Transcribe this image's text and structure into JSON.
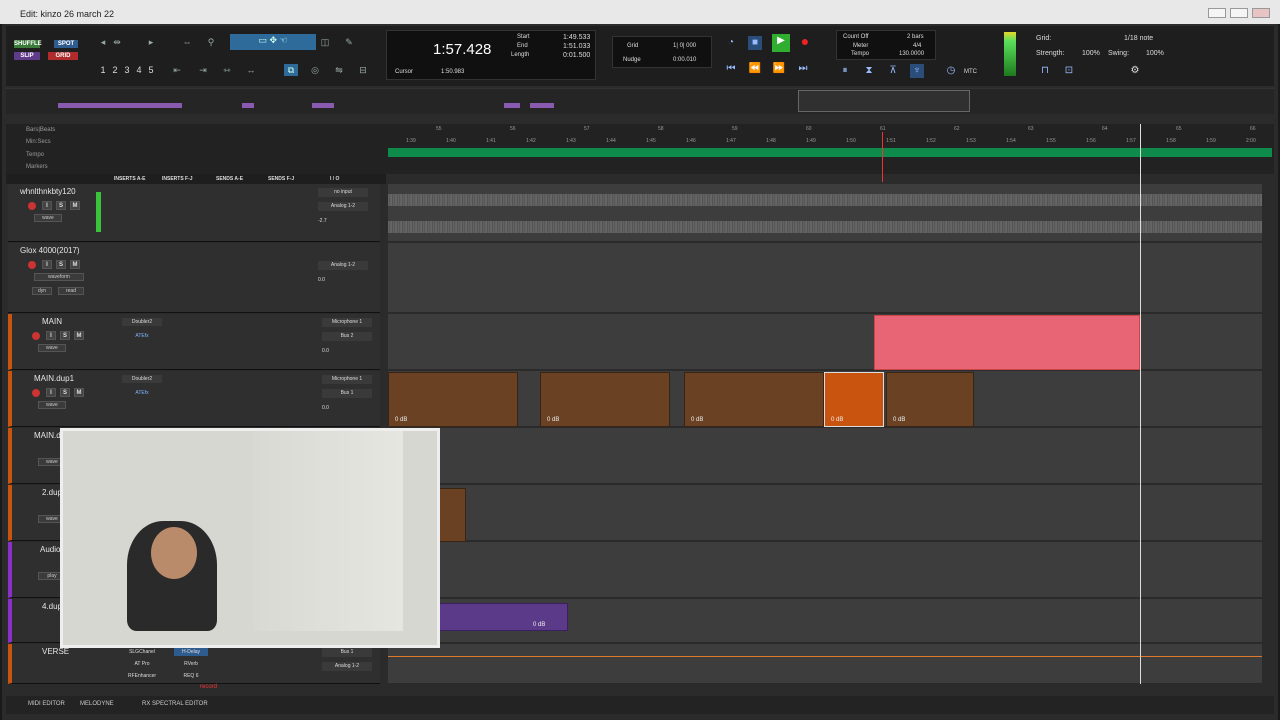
{
  "window": {
    "title": "Edit: kinzo 26 march 22"
  },
  "modes": {
    "shuffle": "SHUFFLE",
    "spot": "SPOT",
    "slip": "SLIP",
    "grid": "GRID"
  },
  "zoom_presets": [
    "1",
    "2",
    "3",
    "4",
    "5"
  ],
  "counter": {
    "main": "1:57.428",
    "start_label": "Start",
    "end_label": "End",
    "length_label": "Length",
    "start": "1:49.533",
    "end": "1:51.033",
    "length": "0:01.500",
    "cursor_label": "Cursor",
    "cursor": "1:50.983"
  },
  "grid_nudge": {
    "grid_label": "Grid",
    "grid_value": "1| 0| 000",
    "nudge_label": "Nudge",
    "nudge_value": "0:00.010"
  },
  "tempo": {
    "count_off": "Count Off",
    "meter_label": "Meter",
    "tempo_label": "Tempo",
    "bars": "2 bars",
    "meter": "4/4",
    "bpm": "130.0000"
  },
  "midi_grid": {
    "grid_label": "Grid:",
    "note": "1/18 note",
    "strength_label": "Strength:",
    "strength": "100%",
    "swing_label": "Swing:",
    "swing": "100%"
  },
  "transport_extra": {
    "mtc": "MTC"
  },
  "rulers": {
    "bars_beats": "Bars|Beats",
    "min_secs": "Min:Secs",
    "tempo": "Tempo",
    "meter": "Meter",
    "markers": "Markers"
  },
  "bar_ticks": [
    "55",
    "56",
    "57",
    "58",
    "59",
    "60",
    "61",
    "62",
    "63",
    "64",
    "65",
    "66"
  ],
  "time_ticks": [
    "1:39",
    "1:40",
    "1:41",
    "1:42",
    "1:43",
    "1:44",
    "1:45",
    "1:46",
    "1:47",
    "1:48",
    "1:49",
    "1:50",
    "1:51",
    "1:52",
    "1:53",
    "1:54",
    "1:55",
    "1:56",
    "1:57",
    "1:58",
    "1:59",
    "2:00"
  ],
  "columns": {
    "inserts_ae": "INSERTS A-E",
    "inserts_fj": "INSERTS F-J",
    "sends_ae": "SENDS A-E",
    "sends_fj": "SENDS F-J",
    "io": "I / O"
  },
  "tracks": [
    {
      "name": "whnlthnkbty120",
      "sub": "wave",
      "input": "no input",
      "output": "Analog 1-2",
      "vol": "-2.7",
      "pan_l": "100",
      "pan_r": "100"
    },
    {
      "name": "Glox 4000(2017)",
      "sub": "waveform",
      "input": "",
      "output": "Analog 1-2",
      "vol": "0.0",
      "pan_l": "100",
      "pan_r": "100",
      "dyn": "dyn",
      "read": "read"
    },
    {
      "name": "MAIN",
      "sub": "wave",
      "insert1": "Doubler2",
      "insert2": "ATEfx",
      "input": "Microphone 1",
      "output": "Bus 2",
      "vol": "0.0"
    },
    {
      "name": "MAIN.dup1",
      "sub": "wave",
      "insert1": "Doubler2",
      "insert2": "ATEfx",
      "input": "Microphone 1",
      "output": "Bus 1",
      "vol": "0.0"
    },
    {
      "name": "MAIN.du",
      "sub": "wave"
    },
    {
      "name": "2.dup1",
      "sub": "wave"
    },
    {
      "name": "Audio 2",
      "sub": "play"
    },
    {
      "name": "4.dup1",
      "sub": ""
    },
    {
      "name": "VERSE",
      "sub": "volume",
      "insert1": "SLGChanel",
      "insert2": "AT Pro",
      "insert3": "RFEnhancer",
      "insert_f": "H-Delay",
      "insert_g": "RVerb",
      "insert_h": "REQ 6",
      "input": "Bus 1",
      "output": "Analog 1-2"
    }
  ],
  "clip_db": "0 dB",
  "bottom": {
    "midi_editor": "MIDI EDITOR",
    "melodyne": "MELODYNE",
    "rx": "RX SPECTRAL EDITOR",
    "record": "record"
  },
  "colors": {
    "accent_clip": "#c95410",
    "pink_clip": "#e86575",
    "timeline_green": "#0e8a4b",
    "orange_clip": "#6a4223"
  }
}
